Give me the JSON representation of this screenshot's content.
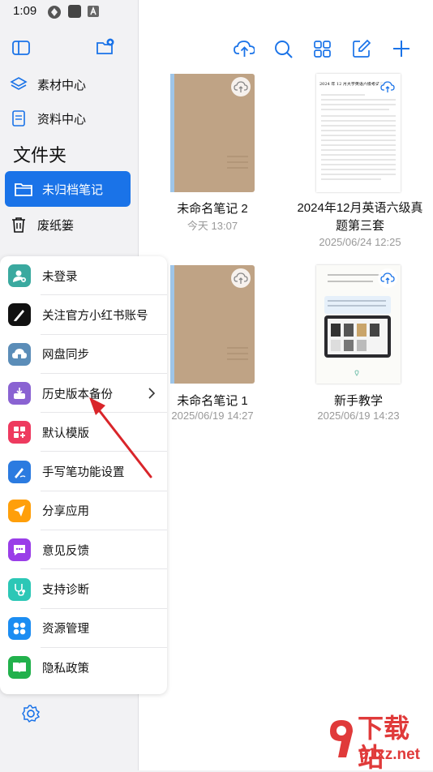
{
  "status_bar": {
    "time": "1:09"
  },
  "sidebar": {
    "items": [
      {
        "label": "素材中心"
      },
      {
        "label": "资料中心"
      }
    ],
    "folders_title": "文件夹",
    "folders": [
      {
        "label": "未归档笔记"
      },
      {
        "label": "废纸篓"
      }
    ]
  },
  "menu": {
    "items": [
      {
        "label": "未登录",
        "icon": "user-icon",
        "color": "#3aa99f"
      },
      {
        "label": "关注官方小红书账号",
        "icon": "pen-icon",
        "color": "#111111"
      },
      {
        "label": "网盘同步",
        "icon": "cloud-drive-icon",
        "color": "#5b8db8"
      },
      {
        "label": "历史版本备份",
        "icon": "backup-icon",
        "color": "#8a63d2"
      },
      {
        "label": "默认模版",
        "icon": "template-icon",
        "color": "#ee3a5f"
      },
      {
        "label": "手写笔功能设置",
        "icon": "stylus-icon",
        "color": "#2b7be0"
      },
      {
        "label": "分享应用",
        "icon": "share-icon",
        "color": "#ff9f0a"
      },
      {
        "label": "意见反馈",
        "icon": "feedback-icon",
        "color": "#9a3ee8"
      },
      {
        "label": "支持诊断",
        "icon": "stethoscope-icon",
        "color": "#2cc7b6"
      },
      {
        "label": "资源管理",
        "icon": "grid-icon",
        "color": "#1c8df2"
      },
      {
        "label": "隐私政策",
        "icon": "book-icon",
        "color": "#22b14c"
      }
    ]
  },
  "notes": [
    {
      "title": "未命名笔记 2",
      "date": "今天 13:07"
    },
    {
      "title": "2024年12月英语六级真题第三套",
      "date": "2025/06/24 12:25",
      "doc_heading": "2024 年 12 月大学英语六级考试真题"
    },
    {
      "title": "未命名笔记 1",
      "date": "2025/06/19 14:27"
    },
    {
      "title": "新手教学",
      "date": "2025/06/19 14:23"
    }
  ],
  "watermark": {
    "text": "下载站",
    "url_text": "91xz.net"
  }
}
